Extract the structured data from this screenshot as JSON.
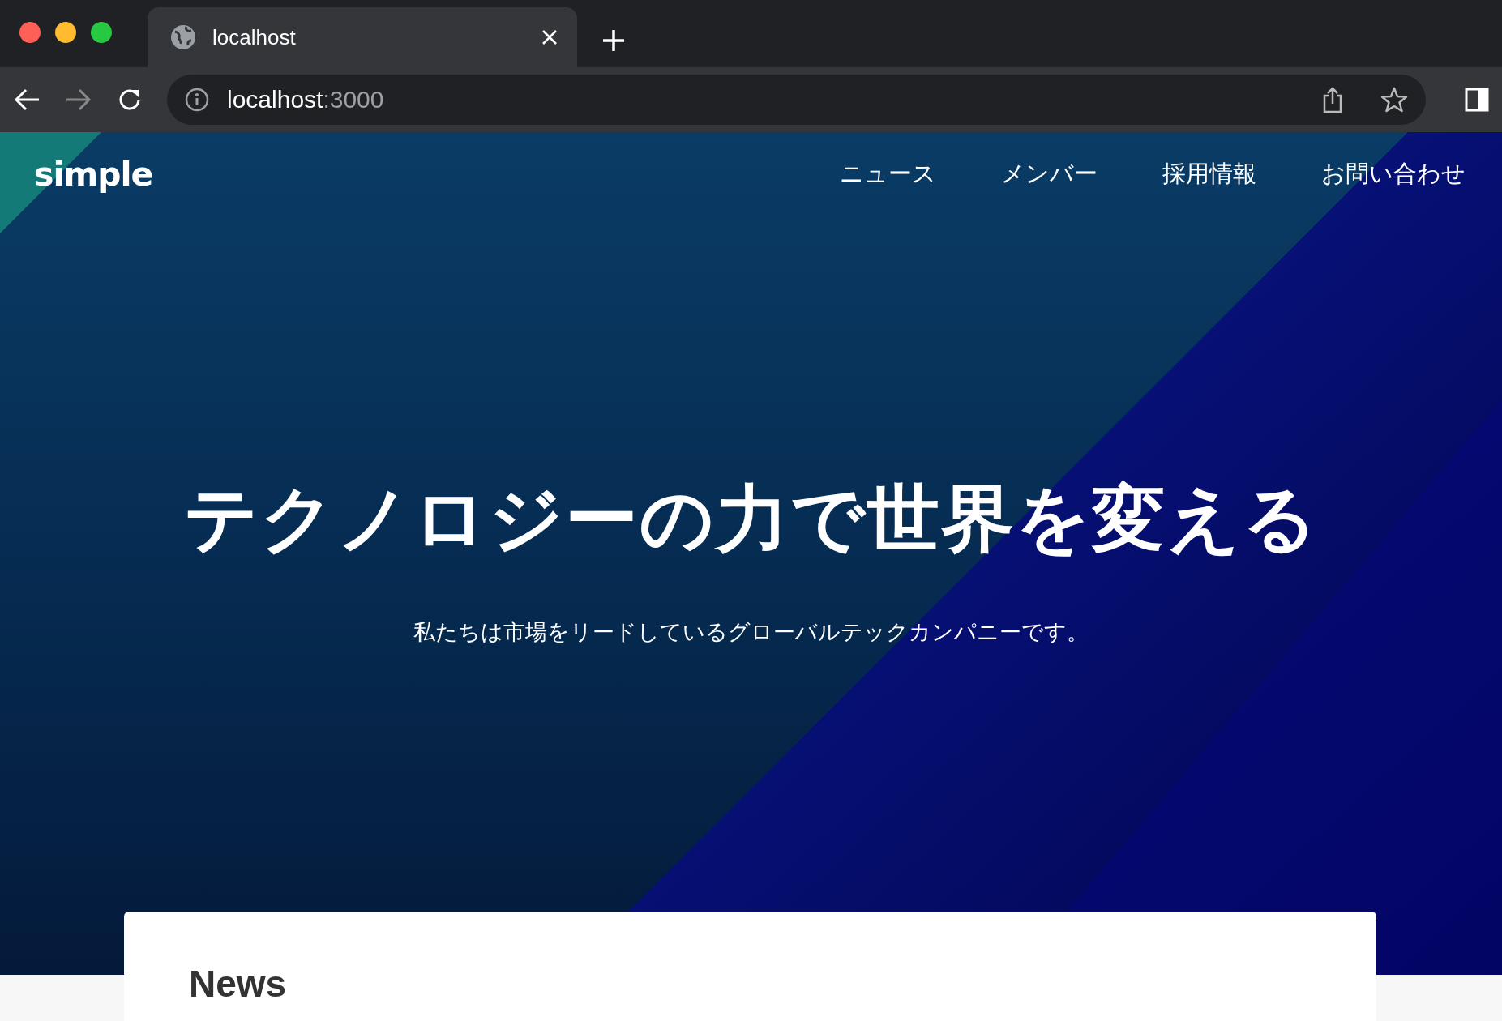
{
  "browser": {
    "tab": {
      "title": "localhost",
      "selected": true
    },
    "address": {
      "host": "localhost",
      "port": ":3000"
    }
  },
  "site": {
    "logo": "simple",
    "nav": [
      {
        "label": "ニュース"
      },
      {
        "label": "メンバー"
      },
      {
        "label": "採用情報"
      },
      {
        "label": "お問い合わせ"
      }
    ]
  },
  "hero": {
    "title": "テクノロジーの力で世界を変える",
    "subtitle": "私たちは市場をリードしているグローバルテックカンパニーです。"
  },
  "news": {
    "heading": "News"
  }
}
